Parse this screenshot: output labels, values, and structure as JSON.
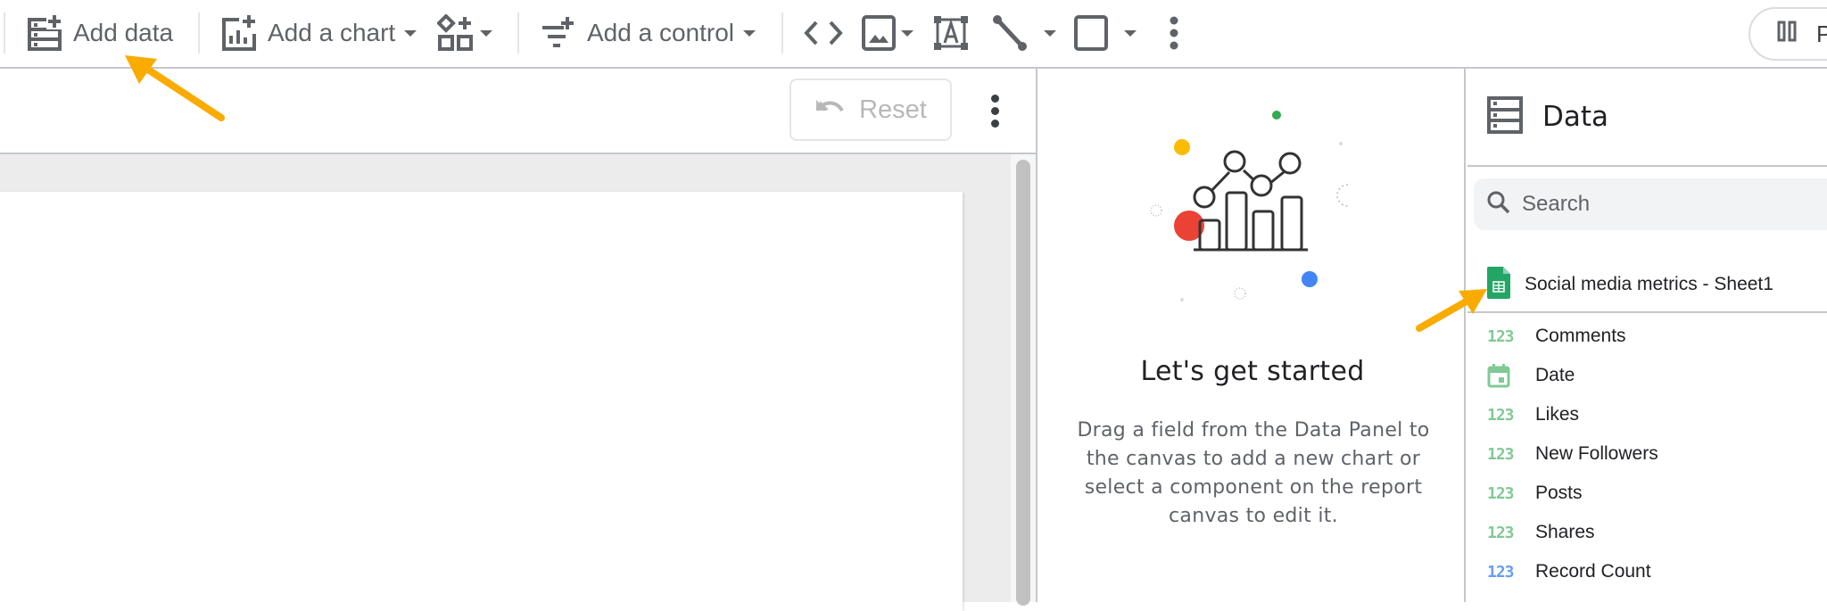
{
  "toolbar": {
    "add_data": "Add data",
    "add_chart": "Add a chart",
    "add_control": "Add a control",
    "right_pill_label": "P"
  },
  "canvas": {
    "reset_label": "Reset"
  },
  "get_started": {
    "title": "Let's get started",
    "body": "Drag a field from the Data Panel to the canvas to add a new chart or select a component on the report canvas to edit it."
  },
  "data_panel": {
    "title": "Data",
    "search_placeholder": "Search",
    "source": "Social media metrics - Sheet1",
    "fields": [
      {
        "label": "Comments",
        "type": "number",
        "icon_text": "123",
        "color": "#81c995"
      },
      {
        "label": "Date",
        "type": "date",
        "icon_text": "",
        "color": "#81c995"
      },
      {
        "label": "Likes",
        "type": "number",
        "icon_text": "123",
        "color": "#81c995"
      },
      {
        "label": "New Followers",
        "type": "number",
        "icon_text": "123",
        "color": "#81c995"
      },
      {
        "label": "Posts",
        "type": "number",
        "icon_text": "123",
        "color": "#81c995"
      },
      {
        "label": "Shares",
        "type": "number",
        "icon_text": "123",
        "color": "#81c995"
      },
      {
        "label": "Record Count",
        "type": "metric",
        "icon_text": "123",
        "color": "#669df6"
      }
    ]
  },
  "colors": {
    "annotation_arrow": "#f9ab00",
    "sheets_green": "#23a566",
    "illus_red": "#ea4335",
    "illus_yellow": "#fbbc04",
    "illus_green": "#34a853",
    "illus_blue": "#4285f4"
  }
}
